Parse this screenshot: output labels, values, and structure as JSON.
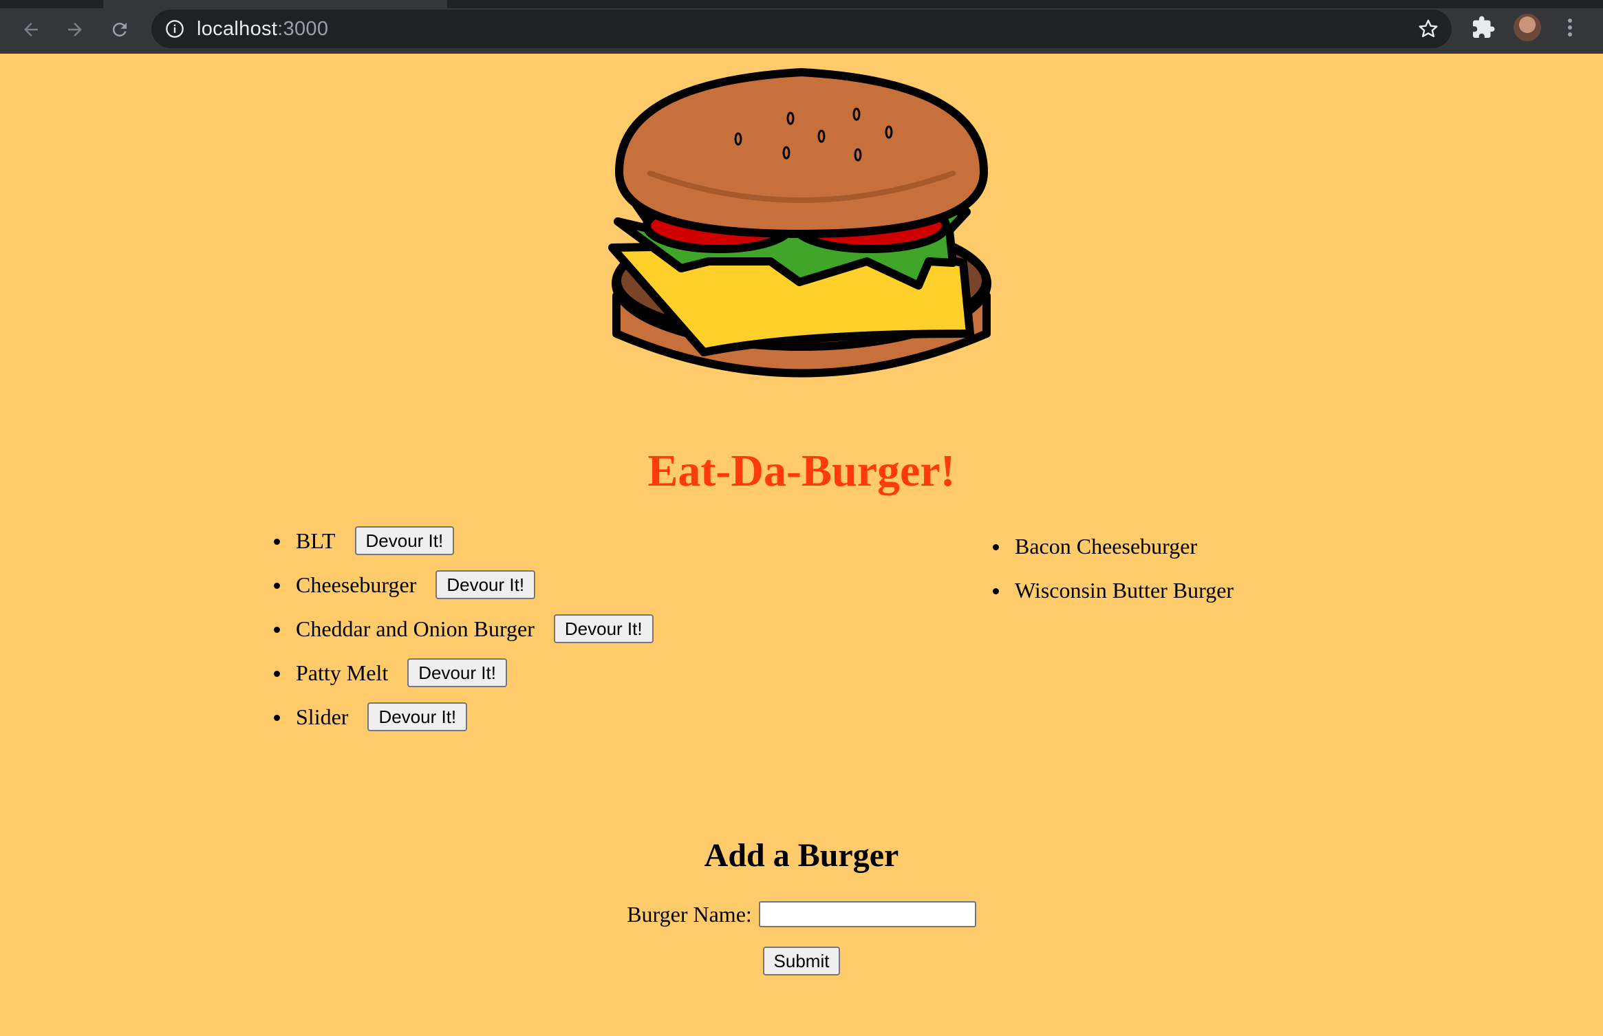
{
  "browser": {
    "url_host": "localhost",
    "url_port": ":3000"
  },
  "page": {
    "title": "Eat-Da-Burger!",
    "burgers_to_devour": [
      {
        "name": "BLT",
        "button": "Devour It!"
      },
      {
        "name": "Cheeseburger",
        "button": "Devour It!"
      },
      {
        "name": "Cheddar and Onion Burger",
        "button": "Devour It!"
      },
      {
        "name": "Patty Melt",
        "button": "Devour It!"
      },
      {
        "name": "Slider",
        "button": "Devour It!"
      }
    ],
    "devoured_burgers": [
      {
        "name": "Bacon Cheeseburger"
      },
      {
        "name": "Wisconsin Butter Burger"
      }
    ],
    "add_form": {
      "title": "Add a Burger",
      "label": "Burger Name:",
      "input_value": "",
      "submit_label": "Submit"
    }
  },
  "colors": {
    "background": "#ffcb6b",
    "title": "#ff3b0e"
  }
}
